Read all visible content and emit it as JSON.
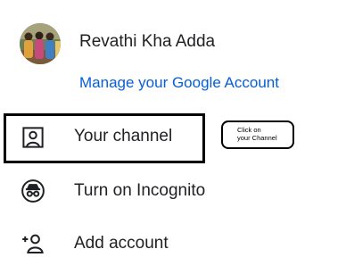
{
  "account": {
    "name": "Revathi Kha Adda",
    "manage_link": "Manage your Google Account"
  },
  "menu": {
    "items": [
      {
        "label": "Your channel",
        "icon": "person-box-icon"
      },
      {
        "label": "Turn on Incognito",
        "icon": "incognito-icon"
      },
      {
        "label": "Add account",
        "icon": "add-person-icon"
      }
    ]
  },
  "annotation": {
    "line1": "Click on",
    "line2": "your Channel"
  },
  "colors": {
    "link": "#065fd4",
    "text": "#202124",
    "annotation_border": "#000000"
  }
}
